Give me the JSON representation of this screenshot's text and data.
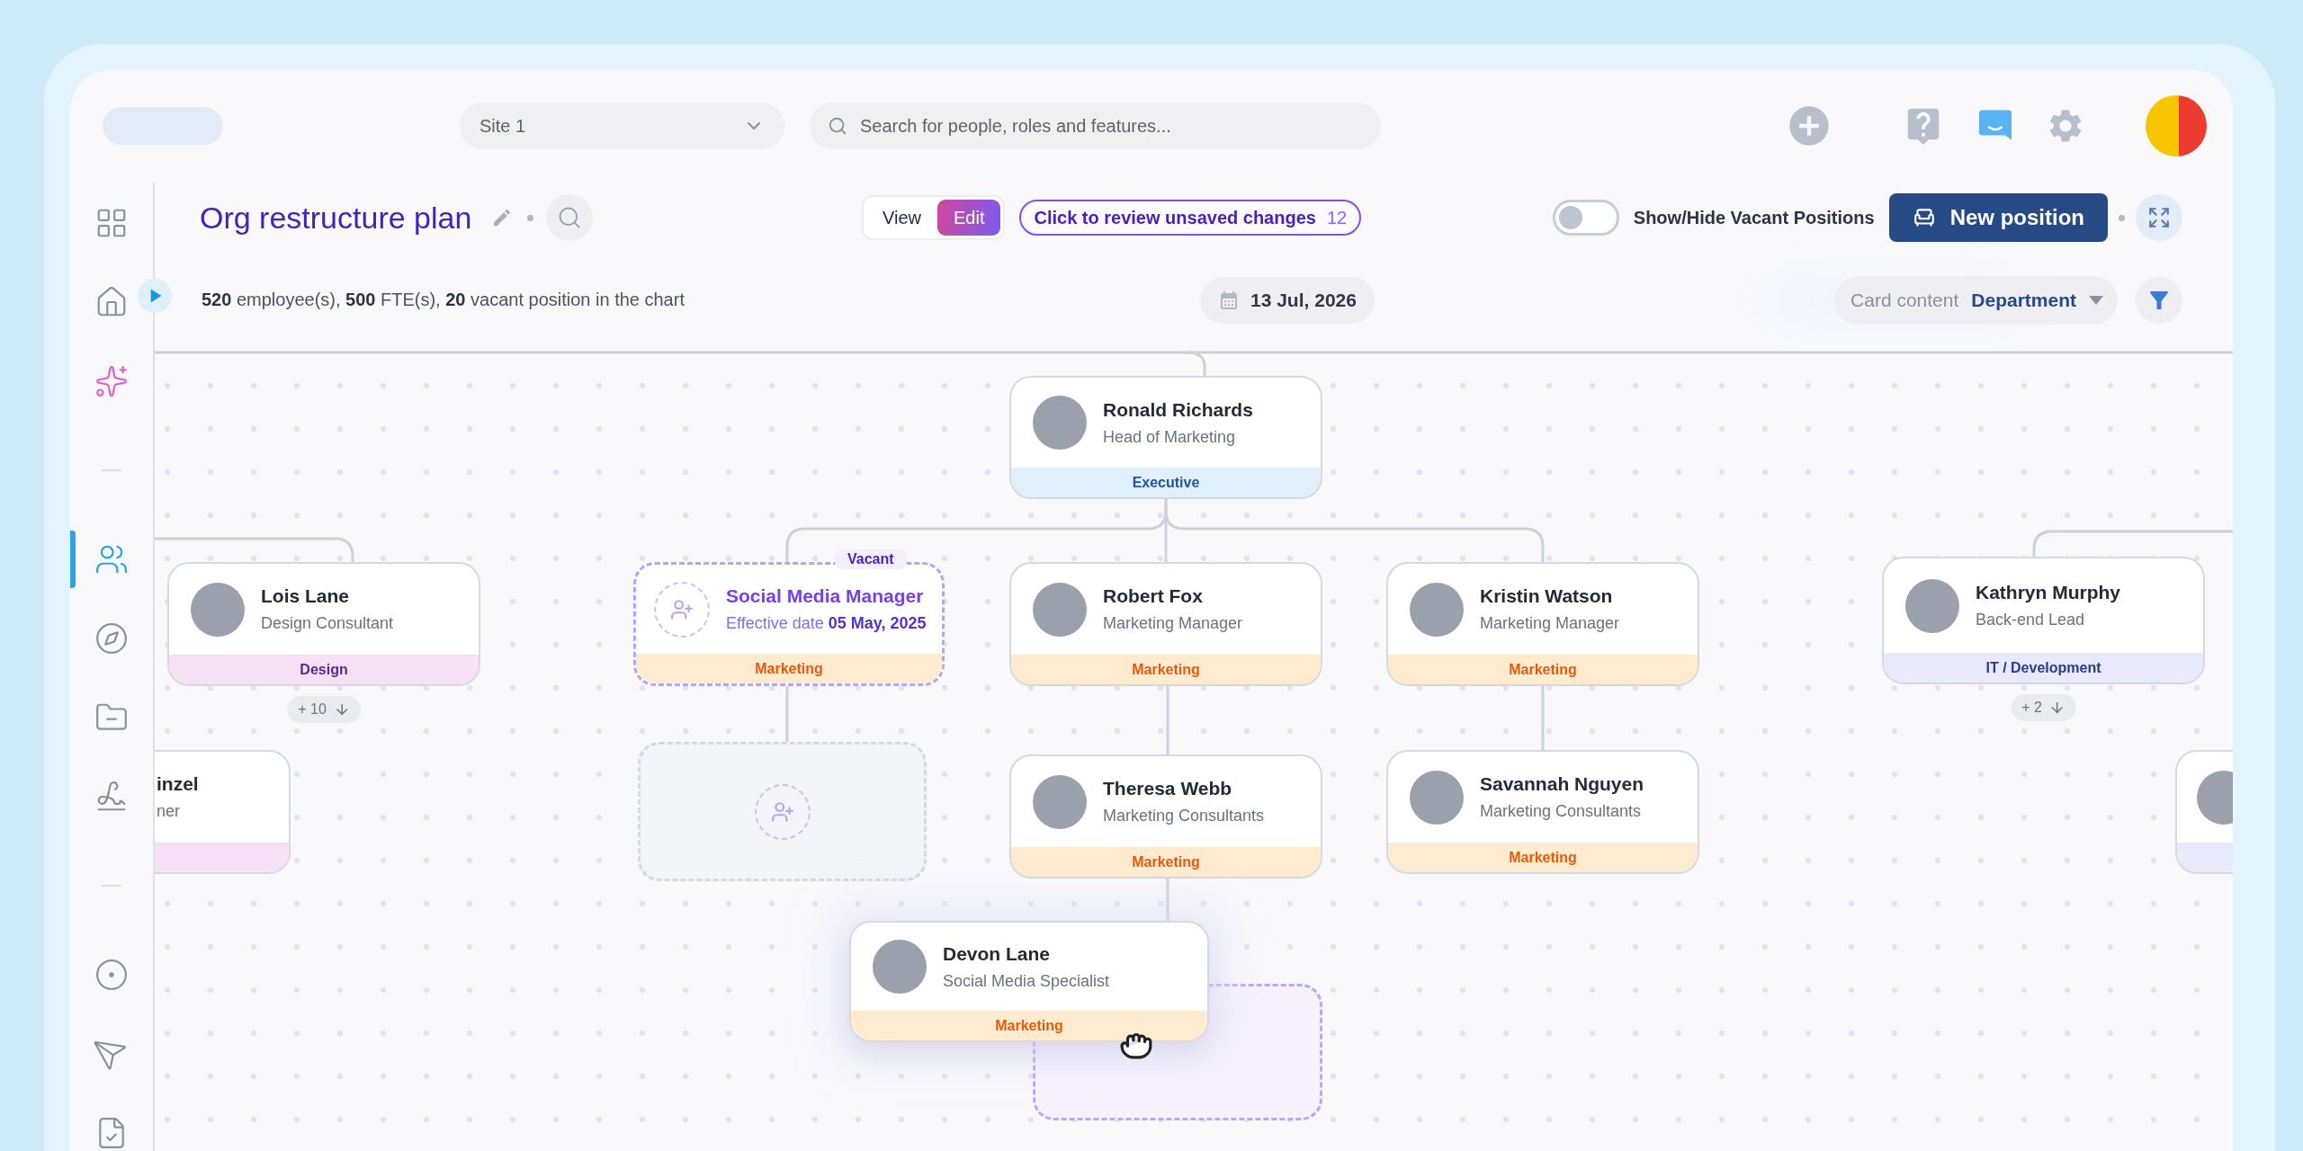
{
  "header": {
    "site_select": {
      "value": "Site 1"
    },
    "search": {
      "placeholder": "Search for people, roles and features..."
    }
  },
  "sidebar": {
    "items": [
      {
        "selected": false
      },
      {
        "selected": false
      },
      {
        "selected": false
      },
      {
        "selected": true
      },
      {
        "selected": false
      },
      {
        "selected": false
      },
      {
        "selected": false
      },
      {
        "selected": false
      },
      {
        "selected": false
      },
      {
        "selected": false
      }
    ]
  },
  "plan": {
    "title": "Org restructure plan",
    "mode_tabs": [
      {
        "label": "View",
        "selected": false
      },
      {
        "label": "Edit",
        "selected": true
      }
    ],
    "unsaved": {
      "label": "Click to review unsaved changes",
      "count": "12"
    },
    "vacant_toggle": {
      "label": "Show/Hide Vacant Positions",
      "on": false
    },
    "new_position": "New position"
  },
  "stats": "**520** employee(s), **500** FTE(s), **20** vacant position in the chart",
  "date": "13 Jul, 2026",
  "card_content": {
    "label": "Card content",
    "value": "Department"
  },
  "chart": {
    "nodes": [
      {
        "kind": "person",
        "name": "Ronald Richards",
        "role": "Head of Marketing",
        "department": "Executive",
        "color": "#e1f1fb",
        "dragging": false
      },
      {
        "kind": "person",
        "name": "Lois Lane",
        "role": "Design Consultant",
        "department": "Design",
        "color": "#f6e0f6",
        "more": "+ 10",
        "dragging": false
      },
      {
        "kind": "partial",
        "name": "inzel",
        "role": "ner",
        "color": "#f6e0f6"
      },
      {
        "kind": "vacant",
        "name": "Social Media Manager",
        "effective_label": "Effective date",
        "effective_date": "05 May, 2025",
        "badge": "Vacant",
        "department": "Marketing",
        "color": "#ffecd0"
      },
      {
        "kind": "person",
        "name": "Robert Fox",
        "role": "Marketing Manager",
        "department": "Marketing",
        "color": "#ffecd0",
        "dragging": false
      },
      {
        "kind": "person",
        "name": "Kristin Watson",
        "role": "Marketing Manager",
        "department": "Marketing",
        "color": "#ffecd0",
        "dragging": false
      },
      {
        "kind": "person",
        "name": "Kathryn Murphy",
        "role": "Back-end Lead",
        "department": "IT / Development",
        "color": "#e8e9fb",
        "more": "+ 2",
        "dragging": false
      },
      {
        "kind": "placeholder"
      },
      {
        "kind": "person",
        "name": "Theresa Webb",
        "role": "Marketing Consultants",
        "department": "Marketing",
        "color": "#ffecd0",
        "dragging": false
      },
      {
        "kind": "person",
        "name": "Savannah Nguyen",
        "role": "Marketing Consultants",
        "department": "Marketing",
        "color": "#ffecd0",
        "dragging": false
      },
      {
        "kind": "edge",
        "color": "#e8e9fb"
      },
      {
        "kind": "drop-target"
      },
      {
        "kind": "person",
        "name": "Devon Lane",
        "role": "Social Media Specialist",
        "department": "Marketing",
        "color": "#ffecd0",
        "dragging": true
      }
    ]
  }
}
